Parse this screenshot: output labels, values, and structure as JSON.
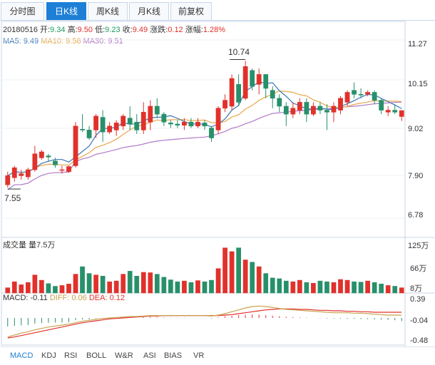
{
  "tabs": [
    "分时图",
    "日K线",
    "周K线",
    "月K线",
    "前复权"
  ],
  "active_tab": 1,
  "info": {
    "date": "20180516",
    "open_label": "开:",
    "open": "9.34",
    "high_label": "高:",
    "high": "9.50",
    "low_label": "低:",
    "low": "9.23",
    "close_label": "收:",
    "close": "9.49",
    "chg_label": "涨跌:",
    "chg": "0.12",
    "pct_label": "涨幅:",
    "pct": "1.28%"
  },
  "ma": {
    "ma5": "MA5: 9.49",
    "ma10": "MA10: 9.56",
    "ma30": "MA30: 9.51"
  },
  "colors": {
    "up": "#e0312b",
    "down": "#27906a",
    "ma5": "#3a76b5",
    "ma10": "#e8a74a",
    "ma30": "#b07ac7",
    "tab_active": "#1e7fd6"
  },
  "price_axis": [
    "11.27",
    "10.15",
    "9.02",
    "7.90",
    "6.78"
  ],
  "high_label": "10.74",
  "low_label": "7.55",
  "volume": {
    "title": "成交量 量7.5万",
    "axis": [
      "125万",
      "66万",
      "8万"
    ]
  },
  "macd": {
    "title": "MACD: -0.11",
    "diff": "DIFF: 0.06",
    "dea": "DEA: 0.12",
    "axis": [
      "0.39",
      "-0.04",
      "-0.48"
    ]
  },
  "bottom_tabs": [
    "MACD",
    "KDJ",
    "RSI",
    "BOLL",
    "W&R",
    "ASI",
    "BIAS",
    "VR"
  ],
  "chart_data": {
    "type": "candlestick",
    "price_ylim": [
      6.78,
      11.27
    ],
    "candles": [
      [
        7.62,
        7.85,
        7.55,
        7.95
      ],
      [
        7.8,
        8.05,
        7.7,
        8.1
      ],
      [
        7.85,
        7.9,
        7.75,
        8.0
      ],
      [
        7.82,
        8.0,
        7.75,
        8.05
      ],
      [
        8.0,
        8.4,
        7.95,
        8.6
      ],
      [
        8.3,
        8.45,
        8.25,
        8.5
      ],
      [
        8.35,
        8.32,
        8.2,
        8.4
      ],
      [
        8.22,
        8.12,
        8.05,
        8.3
      ],
      [
        8.0,
        8.0,
        7.9,
        8.1
      ],
      [
        7.95,
        8.08,
        7.92,
        8.1
      ],
      [
        8.1,
        9.1,
        8.05,
        9.2
      ],
      [
        9.02,
        9.0,
        8.95,
        9.4
      ],
      [
        9.0,
        8.8,
        8.75,
        9.1
      ],
      [
        9.0,
        9.35,
        8.8,
        9.4
      ],
      [
        9.32,
        8.95,
        8.7,
        9.5
      ],
      [
        8.95,
        9.1,
        8.9,
        9.2
      ],
      [
        9.0,
        9.18,
        8.85,
        9.25
      ],
      [
        9.1,
        9.35,
        9.0,
        9.4
      ],
      [
        9.3,
        9.15,
        9.0,
        9.6
      ],
      [
        9.2,
        9.0,
        8.9,
        9.4
      ],
      [
        9.0,
        9.45,
        8.9,
        9.7
      ],
      [
        9.2,
        9.6,
        9.0,
        9.75
      ],
      [
        9.6,
        9.4,
        9.3,
        9.8
      ],
      [
        9.4,
        9.2,
        9.1,
        9.45
      ],
      [
        9.18,
        9.15,
        9.05,
        9.25
      ],
      [
        9.15,
        9.12,
        9.05,
        9.25
      ],
      [
        9.12,
        9.2,
        9.0,
        9.3
      ],
      [
        9.2,
        9.1,
        9.05,
        9.3
      ],
      [
        9.1,
        9.2,
        9.05,
        9.3
      ],
      [
        9.18,
        9.1,
        9.0,
        9.25
      ],
      [
        9.05,
        8.8,
        8.7,
        9.1
      ],
      [
        9.0,
        9.55,
        8.9,
        9.6
      ],
      [
        9.55,
        9.75,
        9.45,
        9.9
      ],
      [
        9.6,
        10.3,
        9.5,
        10.4
      ],
      [
        10.15,
        9.7,
        9.6,
        10.4
      ],
      [
        9.8,
        10.6,
        9.75,
        10.74
      ],
      [
        10.5,
        10.1,
        10.0,
        10.55
      ],
      [
        10.15,
        10.4,
        9.9,
        10.55
      ],
      [
        10.4,
        10.05,
        9.8,
        10.4
      ],
      [
        10.0,
        9.8,
        9.55,
        10.1
      ],
      [
        9.8,
        9.6,
        9.45,
        9.9
      ],
      [
        9.6,
        9.4,
        9.1,
        9.7
      ],
      [
        9.4,
        9.55,
        9.3,
        9.7
      ],
      [
        9.5,
        9.7,
        9.4,
        9.8
      ],
      [
        9.7,
        9.4,
        9.2,
        9.8
      ],
      [
        9.4,
        9.6,
        9.35,
        9.7
      ],
      [
        9.6,
        9.5,
        9.4,
        9.7
      ],
      [
        9.5,
        9.45,
        9.0,
        9.65
      ],
      [
        9.45,
        9.6,
        9.2,
        9.7
      ],
      [
        9.5,
        9.8,
        9.4,
        9.85
      ],
      [
        9.7,
        9.95,
        9.6,
        10.0
      ],
      [
        10.0,
        9.9,
        9.8,
        10.2
      ],
      [
        9.9,
        9.88,
        9.8,
        10.05
      ],
      [
        9.9,
        9.95,
        9.85,
        10.0
      ],
      [
        9.95,
        9.75,
        9.65,
        10.0
      ],
      [
        9.75,
        9.5,
        9.4,
        9.8
      ],
      [
        9.45,
        9.5,
        9.35,
        9.6
      ],
      [
        9.5,
        9.45,
        9.4,
        9.65
      ],
      [
        9.34,
        9.49,
        9.23,
        9.5
      ]
    ],
    "volume_ylim": [
      0,
      125
    ],
    "volume": [
      14,
      30,
      22,
      28,
      48,
      34,
      25,
      18,
      20,
      24,
      50,
      70,
      52,
      48,
      45,
      30,
      32,
      50,
      58,
      45,
      55,
      54,
      50,
      42,
      35,
      30,
      32,
      28,
      33,
      30,
      34,
      65,
      120,
      110,
      120,
      88,
      82,
      70,
      52,
      40,
      38,
      32,
      30,
      34,
      28,
      26,
      32,
      30,
      28,
      36,
      34,
      30,
      29,
      32,
      28,
      24,
      20,
      18,
      14
    ],
    "macd_ylim": [
      -0.48,
      0.39
    ],
    "macd_hist": [
      -0.3,
      -0.28,
      -0.26,
      -0.25,
      -0.2,
      -0.18,
      -0.17,
      -0.16,
      -0.16,
      -0.15,
      -0.08,
      -0.05,
      -0.05,
      -0.02,
      -0.02,
      -0.02,
      0.0,
      0.02,
      0.02,
      0.0,
      0.02,
      0.04,
      0.03,
      0.02,
      0.01,
      0.01,
      0.01,
      0.0,
      0.0,
      0.0,
      -0.02,
      0.02,
      0.06,
      0.08,
      0.1,
      0.11,
      0.12,
      0.12,
      0.1,
      0.08,
      0.06,
      0.04,
      0.03,
      0.02,
      0.01,
      0.0,
      -0.01,
      -0.02,
      -0.02,
      -0.02,
      -0.03,
      -0.03,
      -0.04,
      -0.04,
      -0.05,
      -0.06,
      -0.07,
      -0.08,
      -0.11
    ],
    "macd_diff": [
      -0.4,
      -0.36,
      -0.32,
      -0.29,
      -0.25,
      -0.22,
      -0.19,
      -0.17,
      -0.15,
      -0.13,
      -0.1,
      -0.07,
      -0.05,
      -0.03,
      -0.01,
      0.0,
      0.01,
      0.02,
      0.03,
      0.03,
      0.04,
      0.05,
      0.05,
      0.05,
      0.05,
      0.05,
      0.05,
      0.05,
      0.05,
      0.05,
      0.04,
      0.06,
      0.09,
      0.13,
      0.17,
      0.21,
      0.24,
      0.25,
      0.24,
      0.22,
      0.2,
      0.18,
      0.17,
      0.16,
      0.15,
      0.14,
      0.13,
      0.12,
      0.11,
      0.11,
      0.11,
      0.1,
      0.1,
      0.09,
      0.08,
      0.07,
      0.06,
      0.06,
      0.06
    ],
    "macd_dea": [
      -0.42,
      -0.4,
      -0.37,
      -0.34,
      -0.31,
      -0.28,
      -0.25,
      -0.22,
      -0.19,
      -0.16,
      -0.13,
      -0.1,
      -0.08,
      -0.06,
      -0.04,
      -0.02,
      -0.01,
      0.0,
      0.01,
      0.02,
      0.03,
      0.04,
      0.04,
      0.05,
      0.05,
      0.05,
      0.05,
      0.05,
      0.05,
      0.05,
      0.05,
      0.05,
      0.06,
      0.07,
      0.09,
      0.11,
      0.13,
      0.15,
      0.17,
      0.18,
      0.19,
      0.19,
      0.19,
      0.18,
      0.18,
      0.17,
      0.16,
      0.16,
      0.15,
      0.15,
      0.14,
      0.14,
      0.13,
      0.13,
      0.12,
      0.12,
      0.12,
      0.12,
      0.12
    ]
  }
}
